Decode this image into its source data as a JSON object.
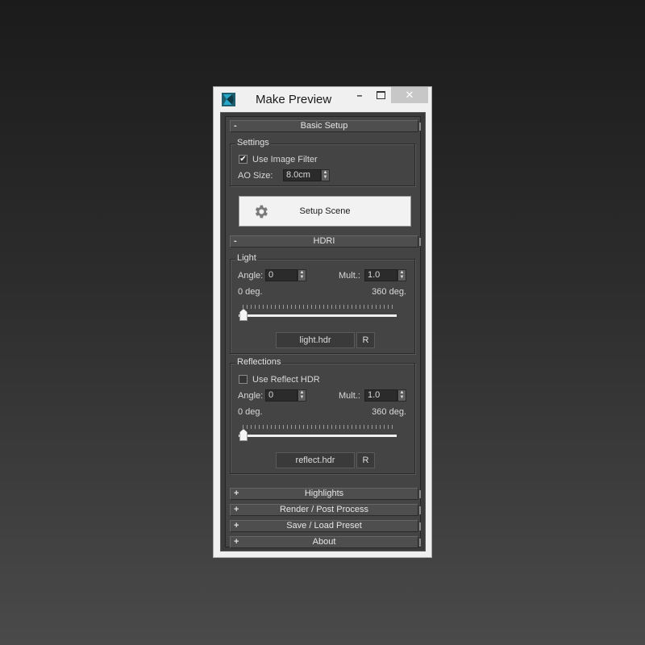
{
  "window": {
    "title": "Make Preview",
    "minimize_label": "–",
    "close_label": "✕"
  },
  "basic_setup": {
    "sign": "-",
    "title": "Basic Setup",
    "settings_group": "Settings",
    "use_image_filter_label": "Use Image Filter",
    "use_image_filter_checked": true,
    "check_mark": "✔",
    "ao_size_label": "AO Size:",
    "ao_size_value": "8.0cm",
    "setup_scene_label": "Setup Scene"
  },
  "hdri": {
    "sign": "-",
    "title": "HDRI",
    "light": {
      "group": "Light",
      "angle_label": "Angle:",
      "angle_value": "0",
      "mult_label": "Mult.:",
      "mult_value": "1.0",
      "min_label": "0 deg.",
      "max_label": "360 deg.",
      "slider_value_deg": 0,
      "file_label": "light.hdr",
      "reset_label": "R"
    },
    "reflections": {
      "group": "Reflections",
      "use_reflect_label": "Use Reflect HDR",
      "use_reflect_checked": false,
      "angle_label": "Angle:",
      "angle_value": "0",
      "mult_label": "Mult.:",
      "mult_value": "1.0",
      "min_label": "0 deg.",
      "max_label": "360 deg.",
      "slider_value_deg": 0,
      "file_label": "reflect.hdr",
      "reset_label": "R"
    }
  },
  "collapsed_rollouts": [
    {
      "sign": "+",
      "title": "Highlights"
    },
    {
      "sign": "+",
      "title": "Render / Post Process"
    },
    {
      "sign": "+",
      "title": "Save / Load Preset"
    },
    {
      "sign": "+",
      "title": "About"
    }
  ],
  "spinner_arrows": {
    "up": "▲",
    "down": "▼"
  },
  "colors": {
    "panel": "#444444",
    "titlebar": "#f0f0f0",
    "accent_icon": "#27a8c8"
  }
}
